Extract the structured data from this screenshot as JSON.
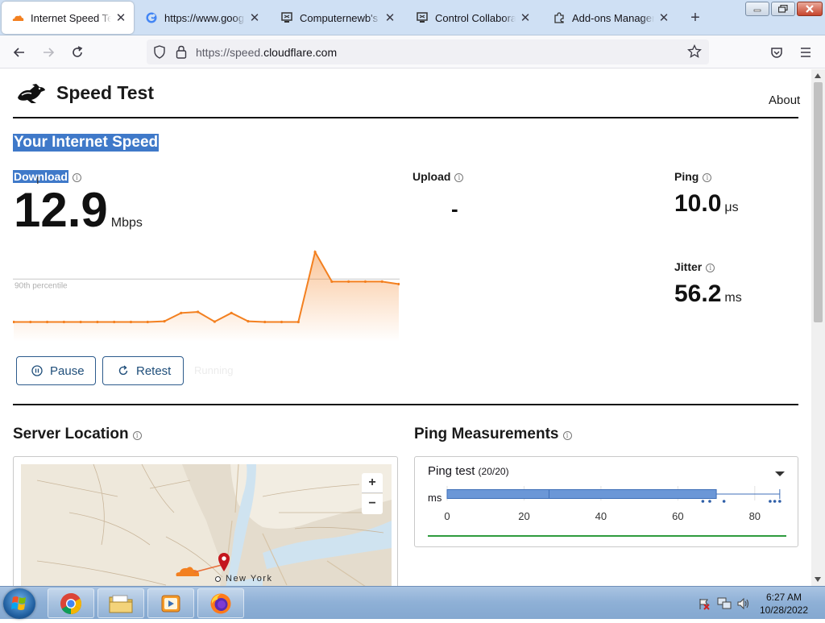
{
  "browser": {
    "tabs": [
      {
        "label": "Internet Speed Test - ",
        "icon": "cloudflare-icon",
        "active": true
      },
      {
        "label": "https://www.google.c",
        "icon": "google-icon",
        "active": false
      },
      {
        "label": "Computernewb's Inte",
        "icon": "computer-icon",
        "active": false
      },
      {
        "label": "Control Collaborative",
        "icon": "computer-icon",
        "active": false
      },
      {
        "label": "Add-ons Manager",
        "icon": "puzzle-icon",
        "active": false
      }
    ],
    "url_prefix": "https://speed.",
    "url_domain": "cloudflare.com",
    "close_glyph": "✕",
    "new_tab_glyph": "+"
  },
  "page": {
    "brand_title": "Speed Test",
    "about_link": "About",
    "section_title": "Your Internet Speed",
    "info_glyph": "i",
    "download": {
      "label": "Download",
      "value": "12.9",
      "unit": "Mbps"
    },
    "upload": {
      "label": "Upload",
      "value": "-"
    },
    "ping": {
      "label": "Ping",
      "value": "10.0",
      "unit": "μs"
    },
    "jitter": {
      "label": "Jitter",
      "value": "56.2",
      "unit": "ms"
    },
    "percentile_label": "90th percentile",
    "pause_label": "Pause",
    "retest_label": "Retest",
    "running_label": "Running",
    "server_location_title": "Server Location",
    "ping_measurements_title": "Ping Measurements",
    "map": {
      "city_label": "New York",
      "zoom_in": "+",
      "zoom_out": "−"
    },
    "ping_test": {
      "title": "Ping test",
      "count": "(20/20)",
      "unit_label": "ms"
    }
  },
  "chart_data": [
    {
      "type": "area",
      "title": "",
      "x": [
        0,
        1,
        2,
        3,
        4,
        5,
        6,
        7,
        8,
        9,
        10,
        11,
        12,
        13,
        14,
        15,
        16,
        17,
        18,
        19,
        20,
        21,
        22,
        23
      ],
      "series": [
        {
          "values": [
            1,
            1,
            1,
            1,
            1,
            1,
            1,
            1,
            1,
            1.2,
            3.5,
            3.8,
            1.1,
            3.5,
            1.2,
            1,
            1,
            1,
            20.4,
            12.2,
            12.2,
            12.2,
            12.2,
            11.5
          ]
        }
      ],
      "reference_line": {
        "label": "90th percentile",
        "value": 12.9
      },
      "color": "#f38020"
    },
    {
      "type": "box",
      "title": "Ping test",
      "xlabel": "ms",
      "xticks": [
        0,
        20,
        40,
        60,
        80
      ],
      "xlim": [
        0,
        88
      ],
      "box": {
        "min": 0,
        "q1": 0,
        "median": 26.5,
        "q3": 70,
        "max": 86.5
      },
      "outliers": [
        66.5,
        68.3,
        72,
        84,
        85.2,
        86.5
      ],
      "color": "#6b97d7"
    }
  ],
  "taskbar": {
    "time": "6:27 AM",
    "date": "10/28/2022",
    "apps": [
      "chrome-icon",
      "file-explorer-icon",
      "media-player-icon",
      "firefox-icon"
    ]
  }
}
